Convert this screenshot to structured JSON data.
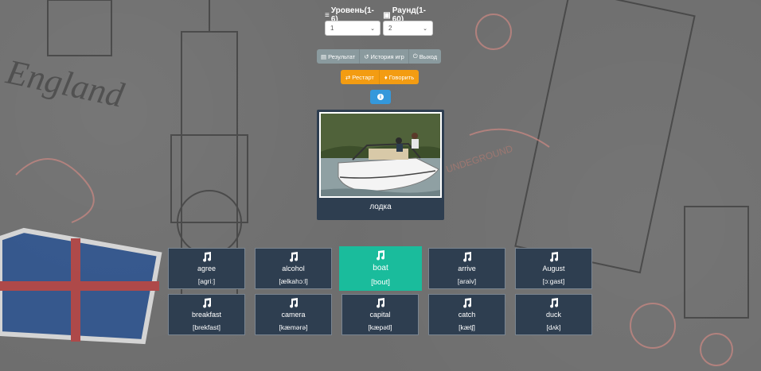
{
  "header": {
    "level_label": "Уровень(1-6)",
    "round_label": "Раунд(1-60)"
  },
  "selects": {
    "level_value": "1",
    "round_value": "2"
  },
  "toolbar": {
    "result_label": "Результат",
    "history_label": "История игр",
    "exit_label": "Выход"
  },
  "actions": {
    "restart_label": "Рестарт",
    "speak_label": "Говорить"
  },
  "card": {
    "translation": "лодка"
  },
  "words": [
    {
      "word": "agree",
      "phonetic": "[agriː]"
    },
    {
      "word": "alcohol",
      "phonetic": "[ælkahɔːl]"
    },
    {
      "word": "boat",
      "phonetic": "[bout]"
    },
    {
      "word": "arrive",
      "phonetic": "[araiv]"
    },
    {
      "word": "August",
      "phonetic": "[ɔːgast]"
    },
    {
      "word": "breakfast",
      "phonetic": "[brekfast]"
    },
    {
      "word": "camera",
      "phonetic": "[kæmərə]"
    },
    {
      "word": "capital",
      "phonetic": "[kæpətl]"
    },
    {
      "word": "catch",
      "phonetic": "[kætʃ]"
    },
    {
      "word": "duck",
      "phonetic": "[dʌk]"
    }
  ],
  "background_text": {
    "left": "England",
    "right": "UNDEGROUND"
  },
  "colors": {
    "card": "#2e3e50",
    "active": "#1abc9c",
    "warning": "#f39c12",
    "info": "#3498db",
    "gray": "#8a9a9e"
  }
}
